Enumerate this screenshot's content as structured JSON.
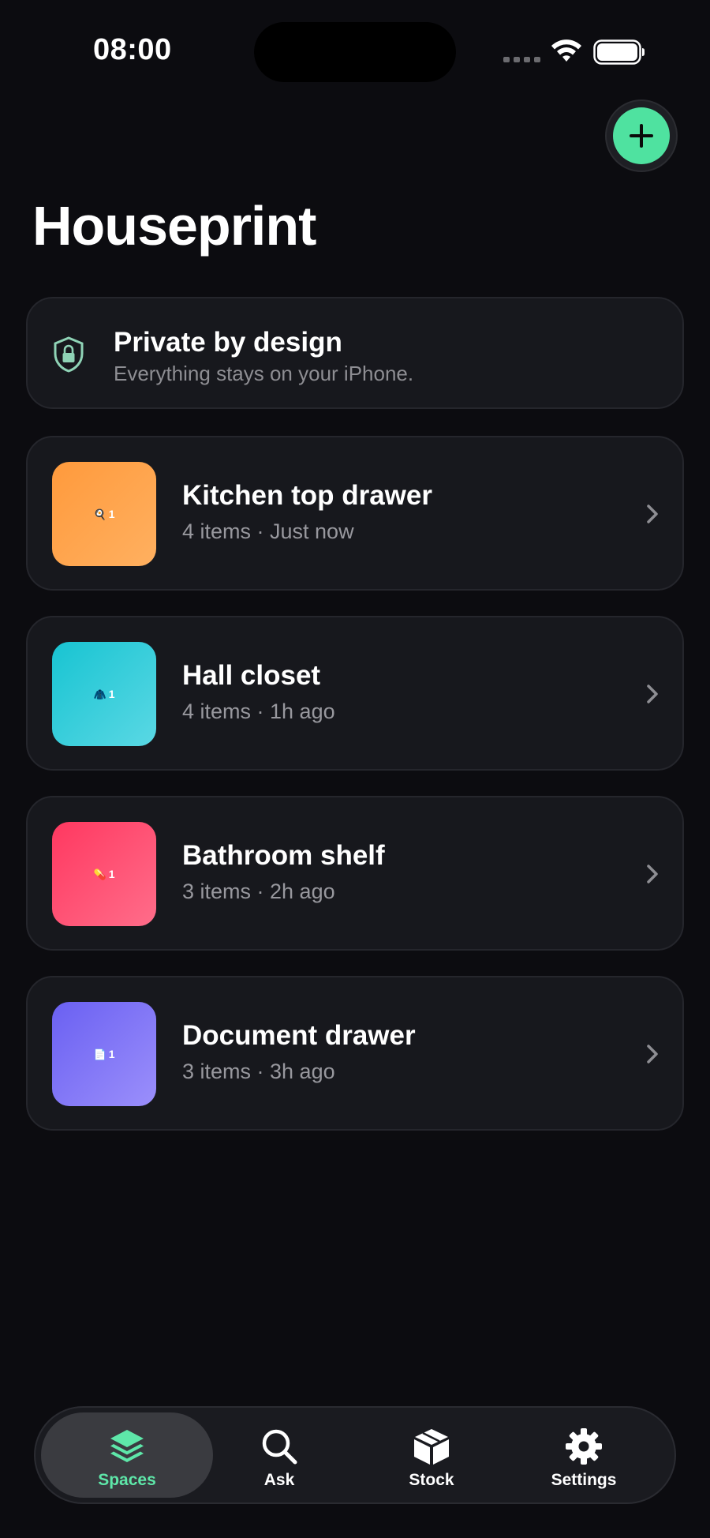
{
  "status_bar": {
    "time": "08:00"
  },
  "header": {
    "title": "Houseprint",
    "add_icon": "plus-icon"
  },
  "privacy": {
    "title": "Private by design",
    "subtitle": "Everything stays on your iPhone.",
    "icon": "shield-lock-icon"
  },
  "spaces": [
    {
      "name": "Kitchen top drawer",
      "meta": "4 items · Just now",
      "emoji": "🍳",
      "count": "1",
      "color_from": "#ff9a3c",
      "color_to": "#ffb060"
    },
    {
      "name": "Hall closet",
      "meta": "4 items · 1h ago",
      "emoji": "🧥",
      "count": "1",
      "color_from": "#18c4d2",
      "color_to": "#5ad8e4"
    },
    {
      "name": "Bathroom shelf",
      "meta": "3 items · 2h ago",
      "emoji": "💊",
      "count": "1",
      "color_from": "#ff3860",
      "color_to": "#ff6d8a"
    },
    {
      "name": "Document drawer",
      "meta": "3 items · 3h ago",
      "emoji": "📄",
      "count": "1",
      "color_from": "#6a60f2",
      "color_to": "#9b8ffb"
    }
  ],
  "tabs": [
    {
      "label": "Spaces",
      "icon": "layers-icon",
      "active": true
    },
    {
      "label": "Ask",
      "icon": "search-icon",
      "active": false
    },
    {
      "label": "Stock",
      "icon": "box-icon",
      "active": false
    },
    {
      "label": "Settings",
      "icon": "gear-icon",
      "active": false
    }
  ],
  "colors": {
    "accent": "#4fe2a0",
    "background": "#0c0c10",
    "card": "#17181d"
  }
}
